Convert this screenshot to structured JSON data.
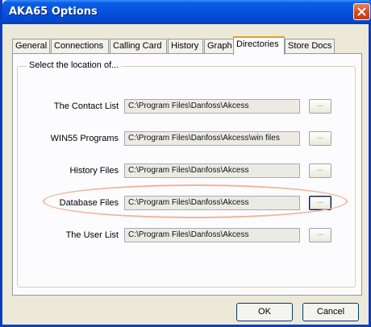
{
  "window": {
    "title": "AKA65 Options"
  },
  "tabs": [
    {
      "label": "General"
    },
    {
      "label": "Connections"
    },
    {
      "label": "Calling Card"
    },
    {
      "label": "History"
    },
    {
      "label": "Graph"
    },
    {
      "label": "Directories",
      "active": true
    },
    {
      "label": "Store Docs"
    }
  ],
  "group": {
    "legend": "Select the location of..."
  },
  "rows": [
    {
      "label": "The Contact List",
      "path": "C:\\Program Files\\Danfoss\\Akcess",
      "browse": "..."
    },
    {
      "label": "WIN55 Programs",
      "path": "C:\\Program Files\\Danfoss\\Akcess\\win files",
      "browse": "..."
    },
    {
      "label": "History Files",
      "path": "C:\\Program Files\\Danfoss\\Akcess",
      "browse": "..."
    },
    {
      "label": "Database Files",
      "path": "C:\\Program Files\\Danfoss\\Akcess",
      "browse": "...",
      "highlighted": true
    },
    {
      "label": "The User List",
      "path": "C:\\Program Files\\Danfoss\\Akcess",
      "browse": "..."
    }
  ],
  "buttons": {
    "ok": "OK",
    "cancel": "Cancel"
  },
  "colors": {
    "titlebar": "#0550dc",
    "active_tab_accent": "#e69b2a",
    "highlight_ring": "#f2b49a",
    "close_button": "#d44a1f"
  }
}
